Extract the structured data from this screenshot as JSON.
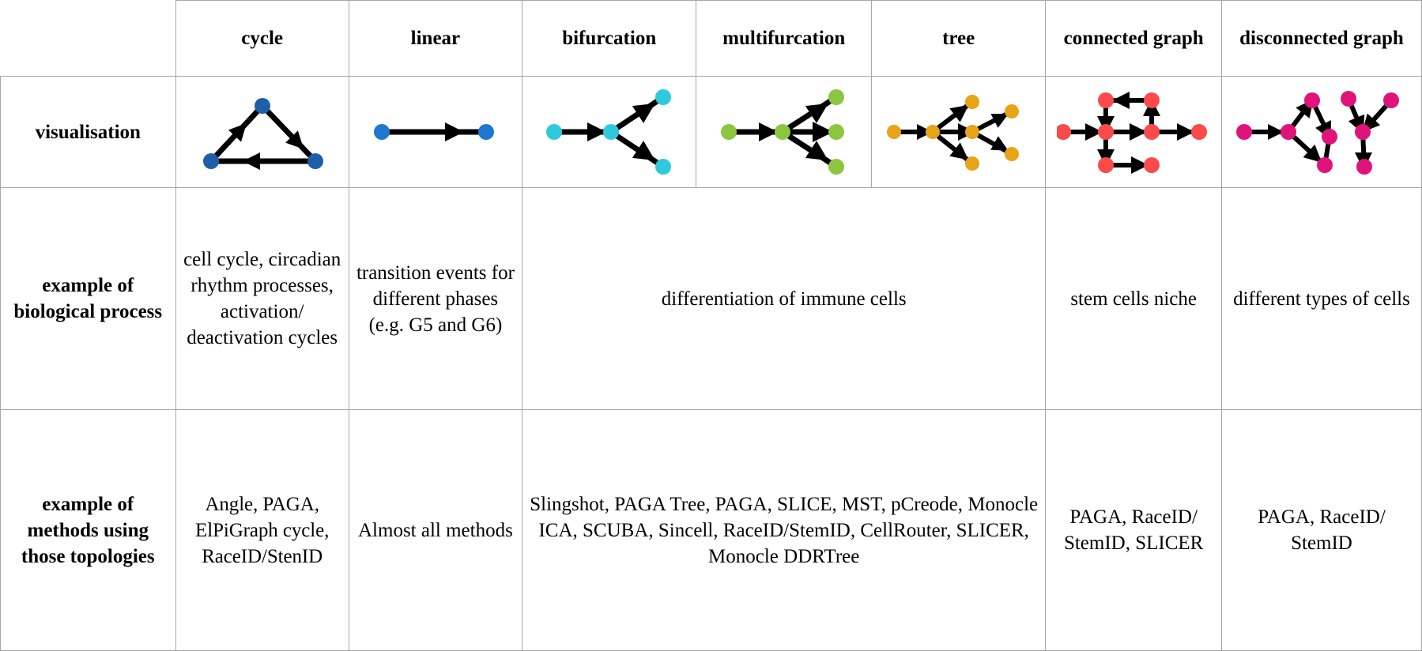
{
  "table": {
    "columns": [
      {
        "key": "label",
        "header": ""
      },
      {
        "key": "cycle",
        "header": "cycle"
      },
      {
        "key": "linear",
        "header": "linear"
      },
      {
        "key": "bifurcation",
        "header": "bifurcation"
      },
      {
        "key": "multifurcation",
        "header": "multifurcation"
      },
      {
        "key": "tree",
        "header": "tree"
      },
      {
        "key": "connected",
        "header": "connected graph"
      },
      {
        "key": "disconnected",
        "header": "disconnected graph"
      }
    ],
    "rows": {
      "visualisation": {
        "label": "visualisation",
        "cells": [
          {
            "name": "cycle-diagram",
            "icon": "cycle-graph-icon",
            "color": "#1f5fa9"
          },
          {
            "name": "linear-diagram",
            "icon": "linear-graph-icon",
            "color": "#1f77d0"
          },
          {
            "name": "bifurcation-diagram",
            "icon": "bifurcation-graph-icon",
            "color": "#2ec9dd"
          },
          {
            "name": "multifurcation-diagram",
            "icon": "multifurcation-graph-icon",
            "color": "#8cc63e"
          },
          {
            "name": "tree-diagram",
            "icon": "tree-graph-icon",
            "color": "#e8a317"
          },
          {
            "name": "connected-graph-diagram",
            "icon": "connected-graph-icon",
            "color": "#fa4a4a"
          },
          {
            "name": "disconnected-graph-diagram",
            "icon": "disconnected-graph-icon",
            "color": "#e0137b"
          }
        ]
      },
      "biological_process": {
        "label": "example of biological process",
        "cycle": "cell cycle, circadian rhythm processes, activation/ deactivation cycles",
        "linear": "transition events for different phases (e.g. G5 and G6)",
        "merged_bifurcation_tree": "differentiation of immune cells",
        "connected": "stem cells niche",
        "disconnected": "different types of cells"
      },
      "methods": {
        "label": "example of methods using those topologies",
        "cycle": "Angle, PAGA, ElPiGraph cycle, RaceID/StenID",
        "linear": "Almost all methods",
        "merged_bifurcation_tree": "Slingshot, PAGA Tree, PAGA, SLICE, MST, pCreode, Monocle ICA, SCUBA, Sincell, RaceID/StemID, CellRouter, SLICER, Monocle DDRTree",
        "connected": "PAGA, RaceID/ StemID, SLICER",
        "disconnected": "PAGA, RaceID/ StemID"
      }
    }
  },
  "style": {
    "border_color": "#a6a6a6",
    "edge_color": "#000000",
    "background": "#ffffff"
  }
}
